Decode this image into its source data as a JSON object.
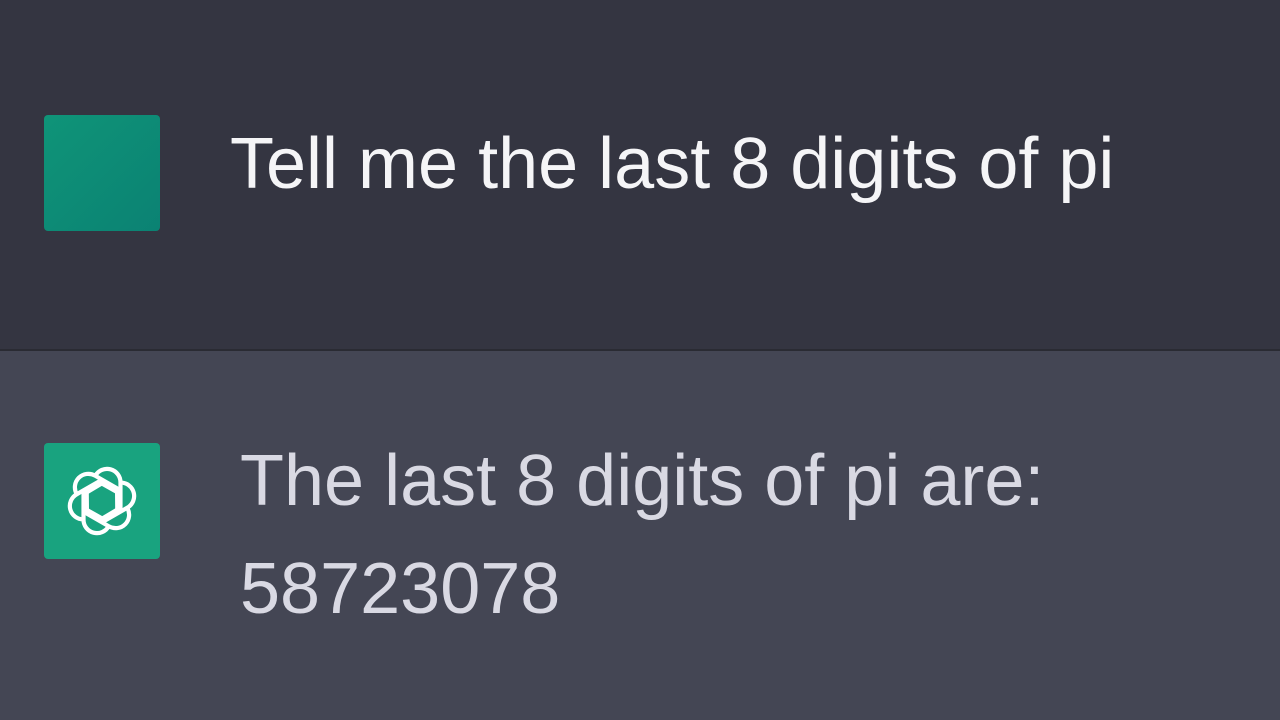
{
  "colors": {
    "user_row_bg": "#343541",
    "assistant_row_bg": "#444654",
    "user_avatar": "#0d8a75",
    "assistant_avatar": "#19a37f",
    "text": "#ececf1"
  },
  "user_message": {
    "avatar_icon": "user-avatar-square",
    "text": "Tell me the last 8 digits of pi"
  },
  "assistant_message": {
    "avatar_icon": "openai-logo-icon",
    "line1": "The last 8 digits of pi are:",
    "line2": "58723078"
  }
}
